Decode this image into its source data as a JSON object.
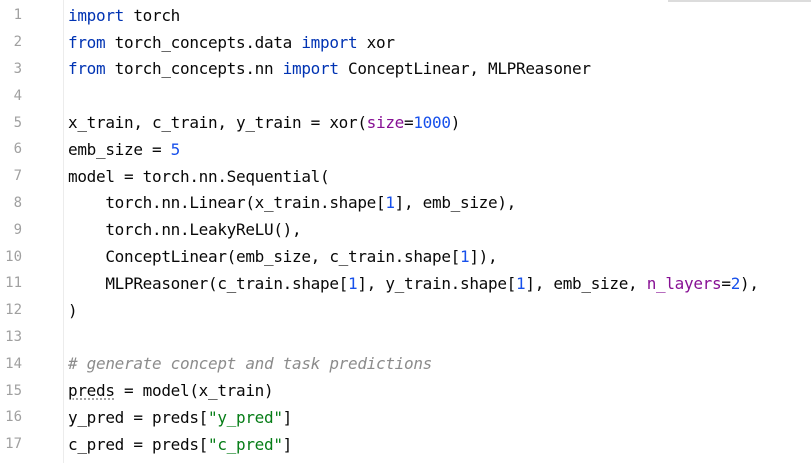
{
  "editor": {
    "line_numbers": [
      "1",
      "2",
      "3",
      "4",
      "5",
      "6",
      "7",
      "8",
      "9",
      "10",
      "11",
      "12",
      "13",
      "14",
      "15",
      "16",
      "17"
    ],
    "lines": [
      [
        {
          "t": "import",
          "c": "kw"
        },
        {
          "t": " torch",
          "c": ""
        }
      ],
      [
        {
          "t": "from",
          "c": "kw"
        },
        {
          "t": " torch_concepts.data ",
          "c": ""
        },
        {
          "t": "import",
          "c": "kw"
        },
        {
          "t": " xor",
          "c": ""
        }
      ],
      [
        {
          "t": "from",
          "c": "kw"
        },
        {
          "t": " torch_concepts.nn ",
          "c": ""
        },
        {
          "t": "import",
          "c": "kw"
        },
        {
          "t": " ConceptLinear, MLPReasoner",
          "c": ""
        }
      ],
      [],
      [
        {
          "t": "x_train, c_train, y_train = xor(",
          "c": ""
        },
        {
          "t": "size",
          "c": "param"
        },
        {
          "t": "=",
          "c": ""
        },
        {
          "t": "1000",
          "c": "num"
        },
        {
          "t": ")",
          "c": ""
        }
      ],
      [
        {
          "t": "emb_size = ",
          "c": ""
        },
        {
          "t": "5",
          "c": "num"
        }
      ],
      [
        {
          "t": "model = torch.nn.Sequential(",
          "c": ""
        }
      ],
      [
        {
          "t": "    torch.nn.Linear(x_train.shape[",
          "c": ""
        },
        {
          "t": "1",
          "c": "num"
        },
        {
          "t": "], emb_size),",
          "c": ""
        }
      ],
      [
        {
          "t": "    torch.nn.LeakyReLU(),",
          "c": ""
        }
      ],
      [
        {
          "t": "    ConceptLinear(emb_size, c_train.shape[",
          "c": ""
        },
        {
          "t": "1",
          "c": "num"
        },
        {
          "t": "]),",
          "c": ""
        }
      ],
      [
        {
          "t": "    MLPReasoner(c_train.shape[",
          "c": ""
        },
        {
          "t": "1",
          "c": "num"
        },
        {
          "t": "], y_train.shape[",
          "c": ""
        },
        {
          "t": "1",
          "c": "num"
        },
        {
          "t": "], emb_size, ",
          "c": ""
        },
        {
          "t": "n_layers",
          "c": "param"
        },
        {
          "t": "=",
          "c": ""
        },
        {
          "t": "2",
          "c": "num"
        },
        {
          "t": "),",
          "c": ""
        }
      ],
      [
        {
          "t": ")",
          "c": ""
        }
      ],
      [],
      [
        {
          "t": "# generate concept and task predictions",
          "c": "cmt"
        }
      ],
      [
        {
          "t": "preds",
          "c": "squiggle"
        },
        {
          "t": " = model(x_train)",
          "c": ""
        }
      ],
      [
        {
          "t": "y_pred = preds[",
          "c": ""
        },
        {
          "t": "\"y_pred\"",
          "c": "str"
        },
        {
          "t": "]",
          "c": ""
        }
      ],
      [
        {
          "t": "c_pred = preds[",
          "c": ""
        },
        {
          "t": "\"c_pred\"",
          "c": "str"
        },
        {
          "t": "]",
          "c": ""
        }
      ]
    ]
  }
}
